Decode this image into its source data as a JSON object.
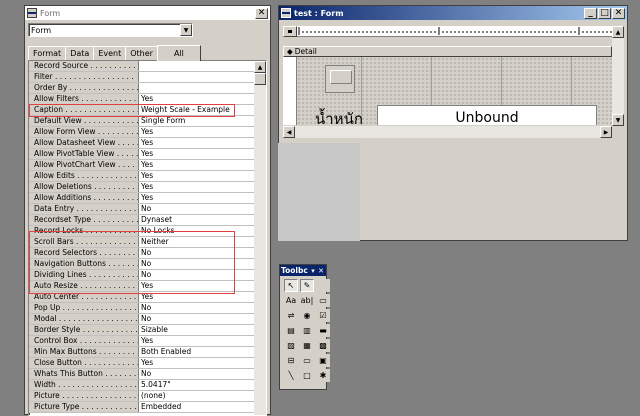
{
  "property_sheet": {
    "title": "Form",
    "object_selector": "Form",
    "tabs": [
      {
        "label": "Format"
      },
      {
        "label": "Data"
      },
      {
        "label": "Event"
      },
      {
        "label": "Other"
      },
      {
        "label": "All",
        "active": true
      }
    ],
    "properties": [
      {
        "name": "Record Source . . . . . . . . . . . .",
        "value": ""
      },
      {
        "name": "Filter . . . . . . . . . . . . . . . . .",
        "value": ""
      },
      {
        "name": "Order By . . . . . . . . . . . . . . .",
        "value": ""
      },
      {
        "name": "Allow Filters . . . . . . . . . . . .",
        "value": "Yes"
      },
      {
        "name": "Caption . . . . . . . . . . . . . . . .",
        "value": "Weight Scale - Example"
      },
      {
        "name": "Default View . . . . . . . . . . . .",
        "value": "Single Form"
      },
      {
        "name": "Allow Form View . . . . . . . . . .",
        "value": "Yes"
      },
      {
        "name": "Allow Datasheet View . . . . . . .",
        "value": "Yes"
      },
      {
        "name": "Allow PivotTable View . . . . . .",
        "value": "Yes"
      },
      {
        "name": "Allow PivotChart View . . . . . .",
        "value": "Yes"
      },
      {
        "name": "Allow Edits . . . . . . . . . . . . .",
        "value": "Yes"
      },
      {
        "name": "Allow Deletions . . . . . . . . . .",
        "value": "Yes"
      },
      {
        "name": "Allow Additions . . . . . . . . . .",
        "value": "Yes"
      },
      {
        "name": "Data Entry . . . . . . . . . . . . . .",
        "value": "No"
      },
      {
        "name": "Recordset Type . . . . . . . . . . .",
        "value": "Dynaset"
      },
      {
        "name": "Record Locks . . . . . . . . . . . .",
        "value": "No Locks"
      },
      {
        "name": "Scroll Bars . . . . . . . . . . . . . .",
        "value": "Neither"
      },
      {
        "name": "Record Selectors . . . . . . . . . .",
        "value": "No"
      },
      {
        "name": "Navigation Buttons . . . . . . . .",
        "value": "No"
      },
      {
        "name": "Dividing Lines . . . . . . . . . . . .",
        "value": "No"
      },
      {
        "name": "Auto Resize . . . . . . . . . . . . .",
        "value": "Yes"
      },
      {
        "name": "Auto Center . . . . . . . . . . . . .",
        "value": "Yes"
      },
      {
        "name": "Pop Up . . . . . . . . . . . . . . . . .",
        "value": "No"
      },
      {
        "name": "Modal . . . . . . . . . . . . . . . . . .",
        "value": "No"
      },
      {
        "name": "Border Style . . . . . . . . . . . . .",
        "value": "Sizable"
      },
      {
        "name": "Control Box . . . . . . . . . . . . .",
        "value": "Yes"
      },
      {
        "name": "Min Max Buttons . . . . . . . . . .",
        "value": "Both Enabled"
      },
      {
        "name": "Close Button . . . . . . . . . . . . .",
        "value": "Yes"
      },
      {
        "name": "Whats This Button . . . . . . . . .",
        "value": "No"
      },
      {
        "name": "Width . . . . . . . . . . . . . . . . . .",
        "value": "5.0417\""
      },
      {
        "name": "Picture . . . . . . . . . . . . . . . . .",
        "value": "(none)"
      },
      {
        "name": "Picture Type . . . . . . . . . . . . .",
        "value": "Embedded"
      }
    ]
  },
  "form_window": {
    "title": "test : Form",
    "section": "Detail",
    "label_text": "น้ำหนัก",
    "textbox_text": "Unbound"
  },
  "toolbox": {
    "title": "Toolbc",
    "tools": [
      {
        "name": "select-objects-tool",
        "glyph": "↖",
        "pressed": true
      },
      {
        "name": "control-wizards-tool",
        "glyph": "✎",
        "pressed": true
      },
      {
        "name": "blank-tool-1",
        "glyph": ""
      },
      {
        "name": "label-tool",
        "glyph": "Aa"
      },
      {
        "name": "textbox-tool",
        "glyph": "ab|"
      },
      {
        "name": "option-group-tool",
        "glyph": "▭"
      },
      {
        "name": "toggle-button-tool",
        "glyph": "⇌"
      },
      {
        "name": "option-button-tool",
        "glyph": "◉"
      },
      {
        "name": "checkbox-tool",
        "glyph": "☑"
      },
      {
        "name": "combo-box-tool",
        "glyph": "▤"
      },
      {
        "name": "list-box-tool",
        "glyph": "▥"
      },
      {
        "name": "command-button-tool",
        "glyph": "▬"
      },
      {
        "name": "image-tool",
        "glyph": "▨"
      },
      {
        "name": "unbound-object-frame-tool",
        "glyph": "▦"
      },
      {
        "name": "bound-object-frame-tool",
        "glyph": "▩"
      },
      {
        "name": "page-break-tool",
        "glyph": "⊟"
      },
      {
        "name": "tab-control-tool",
        "glyph": "▭"
      },
      {
        "name": "subform-tool",
        "glyph": "▣"
      },
      {
        "name": "line-tool",
        "glyph": "╲"
      },
      {
        "name": "rectangle-tool",
        "glyph": "□"
      },
      {
        "name": "more-controls-tool",
        "glyph": "✱"
      }
    ]
  }
}
